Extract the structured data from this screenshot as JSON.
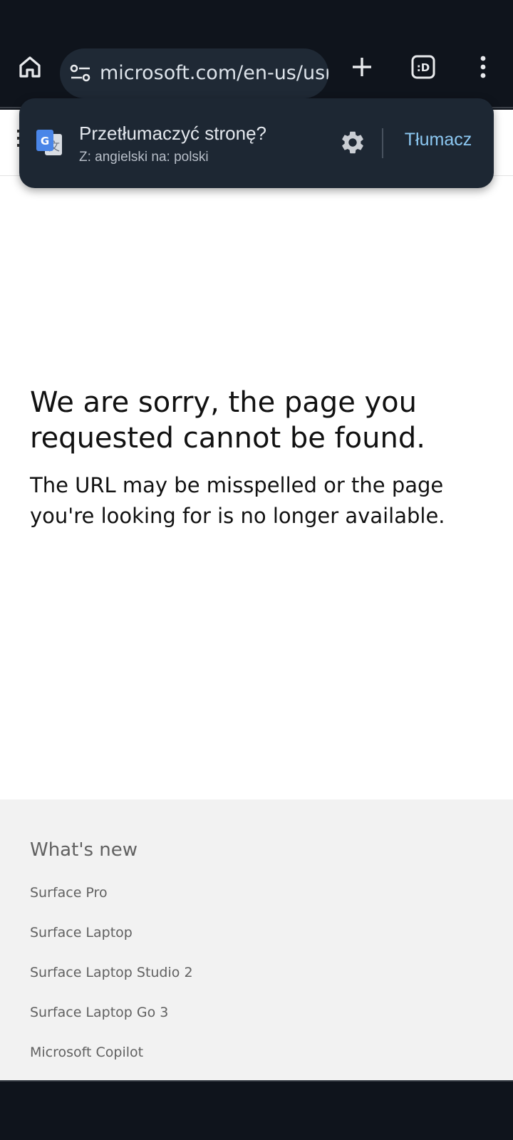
{
  "browser": {
    "url": "microsoft.com/en-us/usr",
    "home_icon": "home-icon",
    "site_info_icon": "tune-icon",
    "new_tab_icon": "plus-icon",
    "tab_switcher_label": ":D",
    "menu_icon": "more-vert-icon"
  },
  "translate_popup": {
    "title": "Przetłumaczyć stronę?",
    "subtitle": "Z: angielski na: polski",
    "settings_icon": "gear-icon",
    "action_label": "Tłumacz"
  },
  "error": {
    "title": "We are sorry, the page you requested cannot be found.",
    "subtitle": "The URL may be misspelled or the page you're looking for is no longer available."
  },
  "footer": {
    "heading": "What's new",
    "links": [
      "Surface Pro",
      "Surface Laptop",
      "Surface Laptop Studio 2",
      "Surface Laptop Go 3",
      "Microsoft Copilot"
    ]
  },
  "colors": {
    "chrome_bg": "#0f141c",
    "popup_bg": "#1d2733",
    "accent": "#8cc8f2",
    "footer_bg": "#f2f2f2"
  }
}
